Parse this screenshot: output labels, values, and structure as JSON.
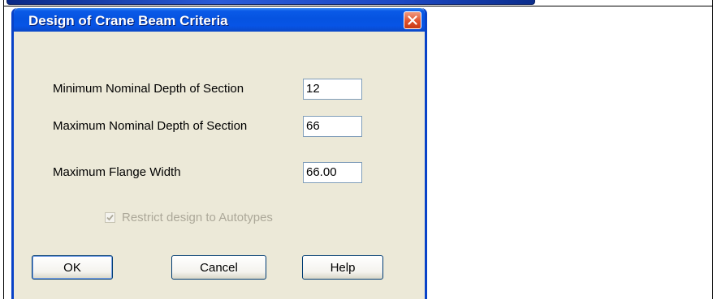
{
  "dialog": {
    "title": "Design of Crane Beam Criteria",
    "fields": [
      {
        "label": "Minimum Nominal Depth of Section",
        "value": "12"
      },
      {
        "label": "Maximum Nominal Depth of Section",
        "value": "66"
      },
      {
        "label": "Maximum Flange Width",
        "value": "66.00"
      }
    ],
    "checkbox": {
      "label": "Restrict design to Autotypes",
      "checked": true,
      "enabled": false
    },
    "buttons": {
      "ok": "OK",
      "cancel": "Cancel",
      "help": "Help"
    }
  },
  "colors": {
    "titlebar": "#0653e0",
    "dialog_face": "#ece9d8",
    "close_button": "#e0512c",
    "disabled_text": "#aca899"
  },
  "icons": {
    "close": "close-icon",
    "checkmark": "checkmark-icon"
  }
}
